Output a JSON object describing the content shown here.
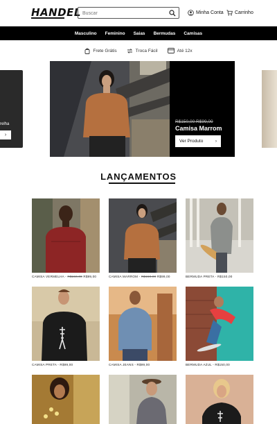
{
  "header": {
    "logo": "HANDEL",
    "search_placeholder": "Buscar",
    "account_label": "Minha Conta",
    "cart_label": "Carrinho"
  },
  "nav": {
    "items": [
      "Masculino",
      "Feminino",
      "Saias",
      "Bermudas",
      "Camisas"
    ]
  },
  "benefits": {
    "items": [
      "Frete Grátis",
      "Troca Fácil",
      "Até 12x"
    ]
  },
  "slider": {
    "left_partial_text": "relha",
    "left_partial_button": "›",
    "hero": {
      "price_old": "R$150,00",
      "price_new": "R$99,00",
      "title": "Camisa Marrom",
      "button_label": "Ver Produto",
      "button_arrow": "›"
    }
  },
  "launches": {
    "title": "LANÇAMENTOS",
    "products": [
      {
        "name": "CAMISA VERMELHA -",
        "old": "R$150,00",
        "price": "R$99,00"
      },
      {
        "name": "CAMISA MARROM -",
        "old": "R$150,00",
        "price": "R$99,00"
      },
      {
        "name": "BERMUDA PRETA - R$150,00",
        "old": "",
        "price": ""
      },
      {
        "name": "CAMISA PRETA - R$99,00",
        "old": "",
        "price": ""
      },
      {
        "name": "CAMISA JEANS - R$99,00",
        "old": "",
        "price": ""
      },
      {
        "name": "BERMUDA AZUL - R$150,00",
        "old": "",
        "price": ""
      },
      {
        "name": "",
        "old": "",
        "price": ""
      },
      {
        "name": "",
        "old": "",
        "price": ""
      },
      {
        "name": "",
        "old": "",
        "price": ""
      }
    ]
  },
  "colors": {
    "brand": "#000000",
    "nav_text": "#ffffff"
  }
}
